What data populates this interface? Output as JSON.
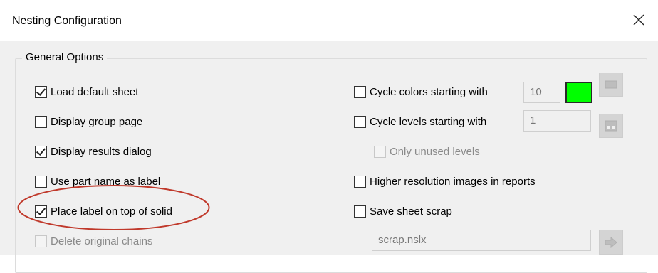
{
  "window": {
    "title": "Nesting Configuration",
    "close_glyph": "✕"
  },
  "general_options": {
    "label": "General Options",
    "left_options": [
      {
        "label": "Load default sheet",
        "checked": true,
        "disabled": false
      },
      {
        "label": "Display group page",
        "checked": false,
        "disabled": false
      },
      {
        "label": "Display results dialog",
        "checked": true,
        "disabled": false
      },
      {
        "label": "Use part name as label",
        "checked": false,
        "disabled": false
      },
      {
        "label": "Place label on top of solid",
        "checked": true,
        "disabled": false
      },
      {
        "label": "Delete original chains",
        "checked": false,
        "disabled": true
      }
    ],
    "right_options": [
      {
        "label": "Cycle colors starting with",
        "checked": false,
        "disabled": false
      },
      {
        "label": "Cycle levels starting with",
        "checked": false,
        "disabled": false
      },
      {
        "label": "Only unused levels",
        "checked": false,
        "disabled": true
      },
      {
        "label": "Higher resolution images in reports",
        "checked": false,
        "disabled": false
      },
      {
        "label": "Save sheet scrap",
        "checked": false,
        "disabled": false
      }
    ],
    "color_start_value": "10",
    "level_start_value": "1",
    "scrap_file_value": "scrap.nslx",
    "swatch_color": "#00ff00"
  },
  "annotation": {
    "highlight_color": "#c0392b"
  },
  "icons": {
    "close": "close-icon",
    "color_picker": "color-palette-icon",
    "level_picker": "levels-icon",
    "scrap_browse": "browse-arrow-icon"
  }
}
